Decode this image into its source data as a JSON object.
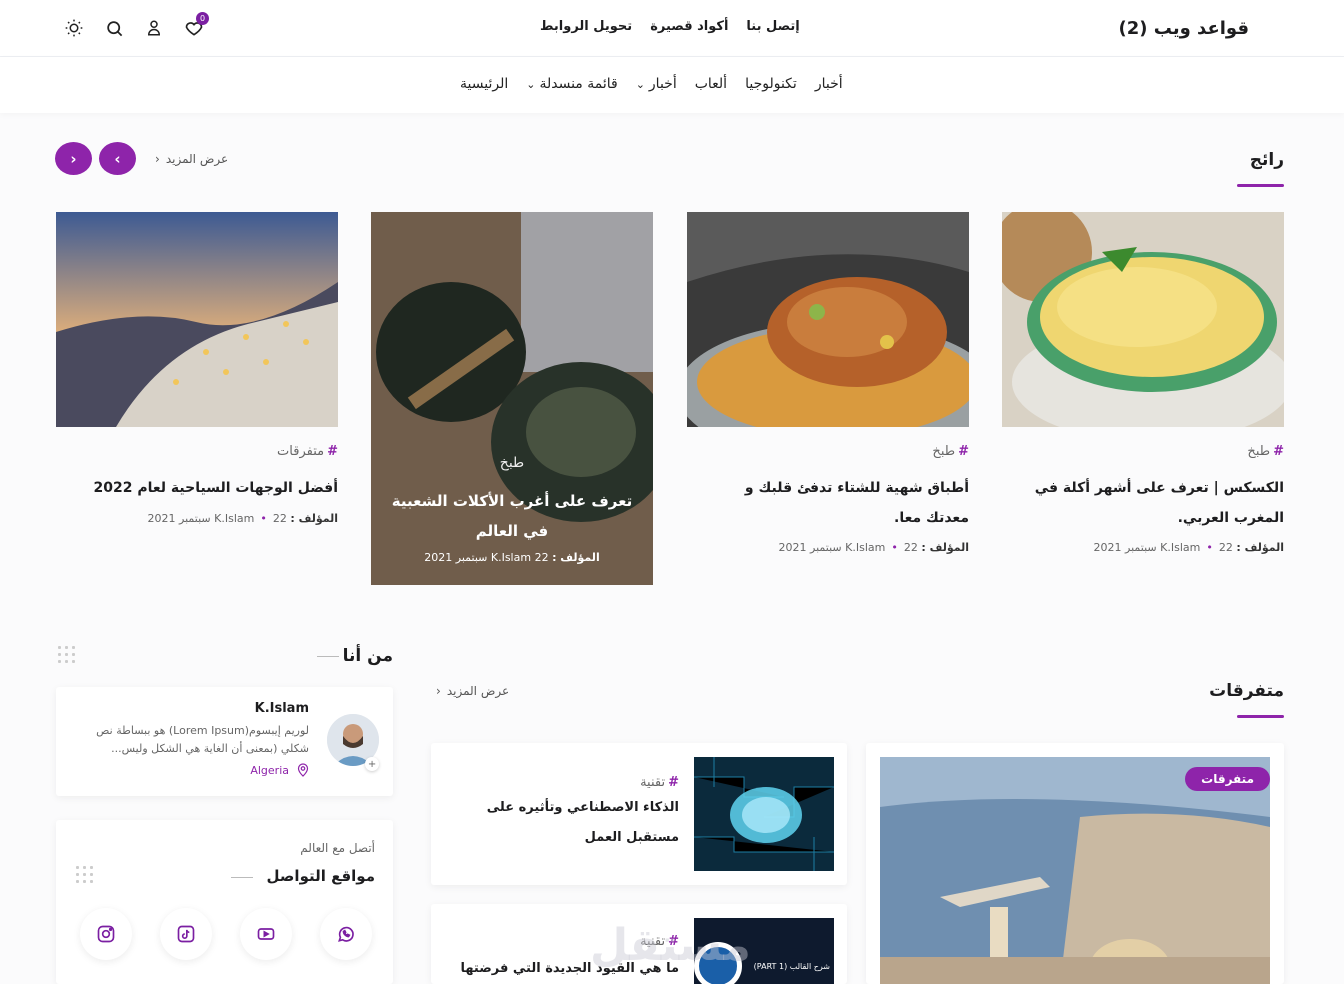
{
  "header": {
    "brand": "قواعد ويب (2)",
    "links": [
      "تحويل الروابط",
      "أكواد قصيرة",
      "إتصل بنا"
    ],
    "wishlist_count": "0"
  },
  "menu": {
    "items": [
      {
        "label": "الرئيسية",
        "dropdown": false
      },
      {
        "label": "قائمة منسدلة",
        "dropdown": true
      },
      {
        "label": "أخبار",
        "dropdown": true
      },
      {
        "label": "ألعاب",
        "dropdown": false
      },
      {
        "label": "تكنولوجيا",
        "dropdown": false
      },
      {
        "label": "أخبار",
        "dropdown": false
      }
    ]
  },
  "featured": {
    "title": "رائج",
    "more": "عرض المزيد",
    "cards": [
      {
        "category": "طبخ",
        "title_lines": [
          "الكسكس | تعرف على أشهر أكلة في",
          "المغرب العربي."
        ],
        "author_label": "المؤلف :",
        "author": "K.Islam",
        "date": "22 سبتمبر 2021"
      },
      {
        "category": "طبخ",
        "title_lines": [
          "أطباق شهية للشتاء تدفئ قلبك و",
          "معدتك معا."
        ],
        "author_label": "المؤلف :",
        "author": "K.Islam",
        "date": "22 سبتمبر 2021"
      },
      {
        "category": "طبخ",
        "title_lines": [
          "تعرف على أغرب الأكلات الشعبية",
          "في العالم"
        ],
        "author_label": "المؤلف :",
        "author": "K.Islam",
        "date": "22 سبتمبر 2021"
      },
      {
        "category": "متفرقات",
        "title_lines": [
          "أفضل الوجهات السياحية لعام 2022"
        ],
        "author_label": "المؤلف :",
        "author": "K.Islam",
        "date": "22 سبتمبر 2021"
      }
    ]
  },
  "misc": {
    "title": "متفرقات",
    "more": "عرض المزيد",
    "big_badge": "متفرقات",
    "posts": [
      {
        "category": "تقنية",
        "title_lines": [
          "الذكاء الاصطناعي وتأثيره على",
          "مستقبل العمل"
        ]
      },
      {
        "category": "تقنية",
        "title_lines": [
          "ما هي القيود الجديدة التي فرضتها"
        ],
        "thumb_text": "شرح القالب (PART 1)"
      }
    ]
  },
  "about": {
    "title": "من أنا",
    "name": "K.Islam",
    "bio": "لوريم إيبسوم(Lorem Ipsum) هو ببساطة نص شكلي (بمعنى أن الغاية هي الشكل وليس...",
    "location": "Algeria"
  },
  "social": {
    "subtitle": "أتصل مع العالم",
    "title": "مواقع التواصل",
    "networks": [
      "whatsapp-icon",
      "youtube-icon",
      "tiktok-icon",
      "instagram-icon"
    ]
  },
  "watermark": "مستقل",
  "colors": {
    "accent": "#8e24aa"
  }
}
